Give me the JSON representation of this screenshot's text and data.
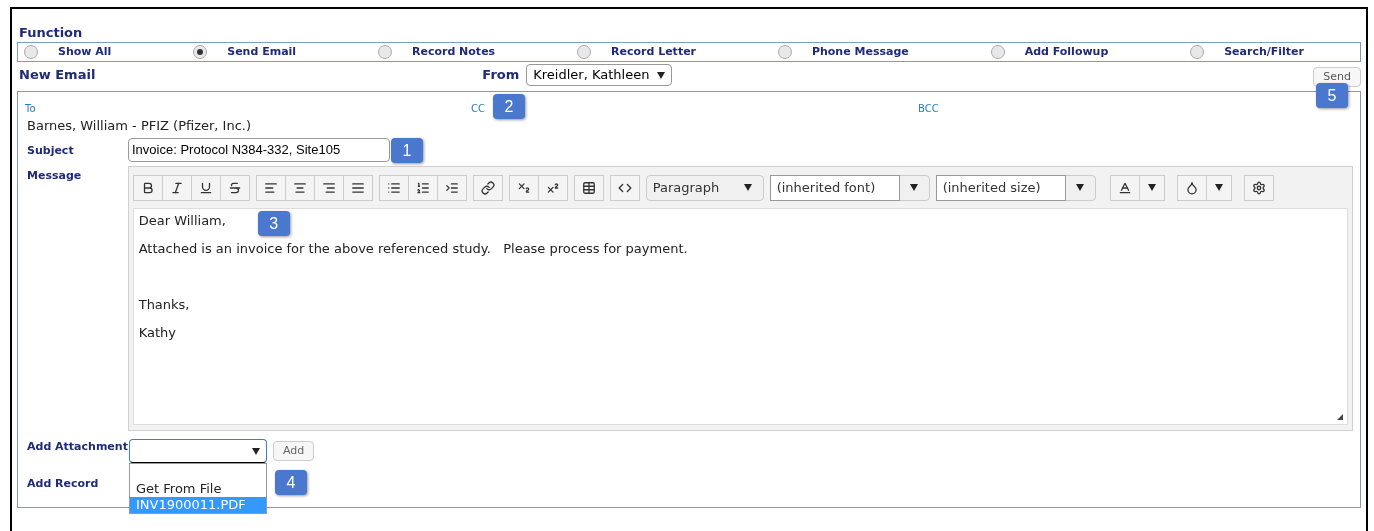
{
  "function": {
    "title": "Function",
    "options": [
      {
        "label": "Show All",
        "selected": false
      },
      {
        "label": "Send Email",
        "selected": true
      },
      {
        "label": "Record Notes",
        "selected": false
      },
      {
        "label": "Record Letter",
        "selected": false
      },
      {
        "label": "Phone Message",
        "selected": false
      },
      {
        "label": "Add Followup",
        "selected": false
      },
      {
        "label": "Search/Filter",
        "selected": false
      }
    ]
  },
  "new_email": {
    "title": "New Email",
    "from_label": "From",
    "from_value": "Kreidler, Kathleen",
    "send_button": "Send",
    "send_callout": "5",
    "recipients": {
      "to_label": "To",
      "to_value": "Barnes, William - PFIZ (Pfizer, Inc.)",
      "cc_label": "CC",
      "cc_callout": "2",
      "bcc_label": "BCC"
    },
    "subject": {
      "label": "Subject",
      "value": "Invoice: Protocol N384-332, Site105",
      "callout": "1"
    },
    "message": {
      "label": "Message",
      "format": "Paragraph",
      "font": "(inherited font)",
      "size": "(inherited size)",
      "callout": "3",
      "lines": [
        {
          "text": "Dear William,",
          "kind": "line"
        },
        {
          "text": "Attached is an invoice for the above referenced study.   Please process for payment.",
          "kind": "line"
        },
        {
          "text": "Thanks,",
          "kind": "gap"
        },
        {
          "text": "Kathy",
          "kind": "line"
        }
      ]
    },
    "attachment": {
      "label": "Add Attachment",
      "add_button": "Add",
      "expanded": true,
      "callout": "4",
      "options": [
        {
          "label": "Get From File",
          "selected": false
        },
        {
          "label": "INV1900011.PDF",
          "selected": true
        }
      ]
    },
    "record": {
      "label": "Add Record"
    }
  }
}
